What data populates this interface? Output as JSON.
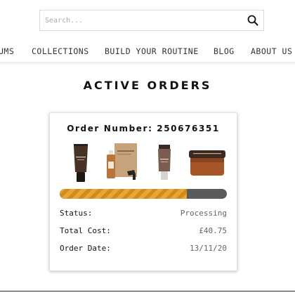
{
  "search": {
    "placeholder": "Search..."
  },
  "nav": {
    "items": [
      {
        "label": "UMS"
      },
      {
        "label": "COLLECTIONS"
      },
      {
        "label": "BUILD YOUR ROUTINE"
      },
      {
        "label": "BLOG"
      },
      {
        "label": "ABOUT US"
      }
    ]
  },
  "page": {
    "title": "ACTIVE ORDERS"
  },
  "order": {
    "number_label": "Order Number: 250676351",
    "progress_percent": 76,
    "products": [
      {
        "name": "tube-product"
      },
      {
        "name": "serum-kit-product"
      },
      {
        "name": "small-tube-product"
      },
      {
        "name": "jar-product"
      }
    ],
    "status_label": "Status:",
    "status_value": "Processing",
    "cost_label": "Total Cost:",
    "cost_value": "£40.75",
    "date_label": "Order Date:",
    "date_value": "13/11/20"
  },
  "colors": {
    "progress_fill": "#e8a634",
    "progress_track": "#5a5a5a"
  }
}
